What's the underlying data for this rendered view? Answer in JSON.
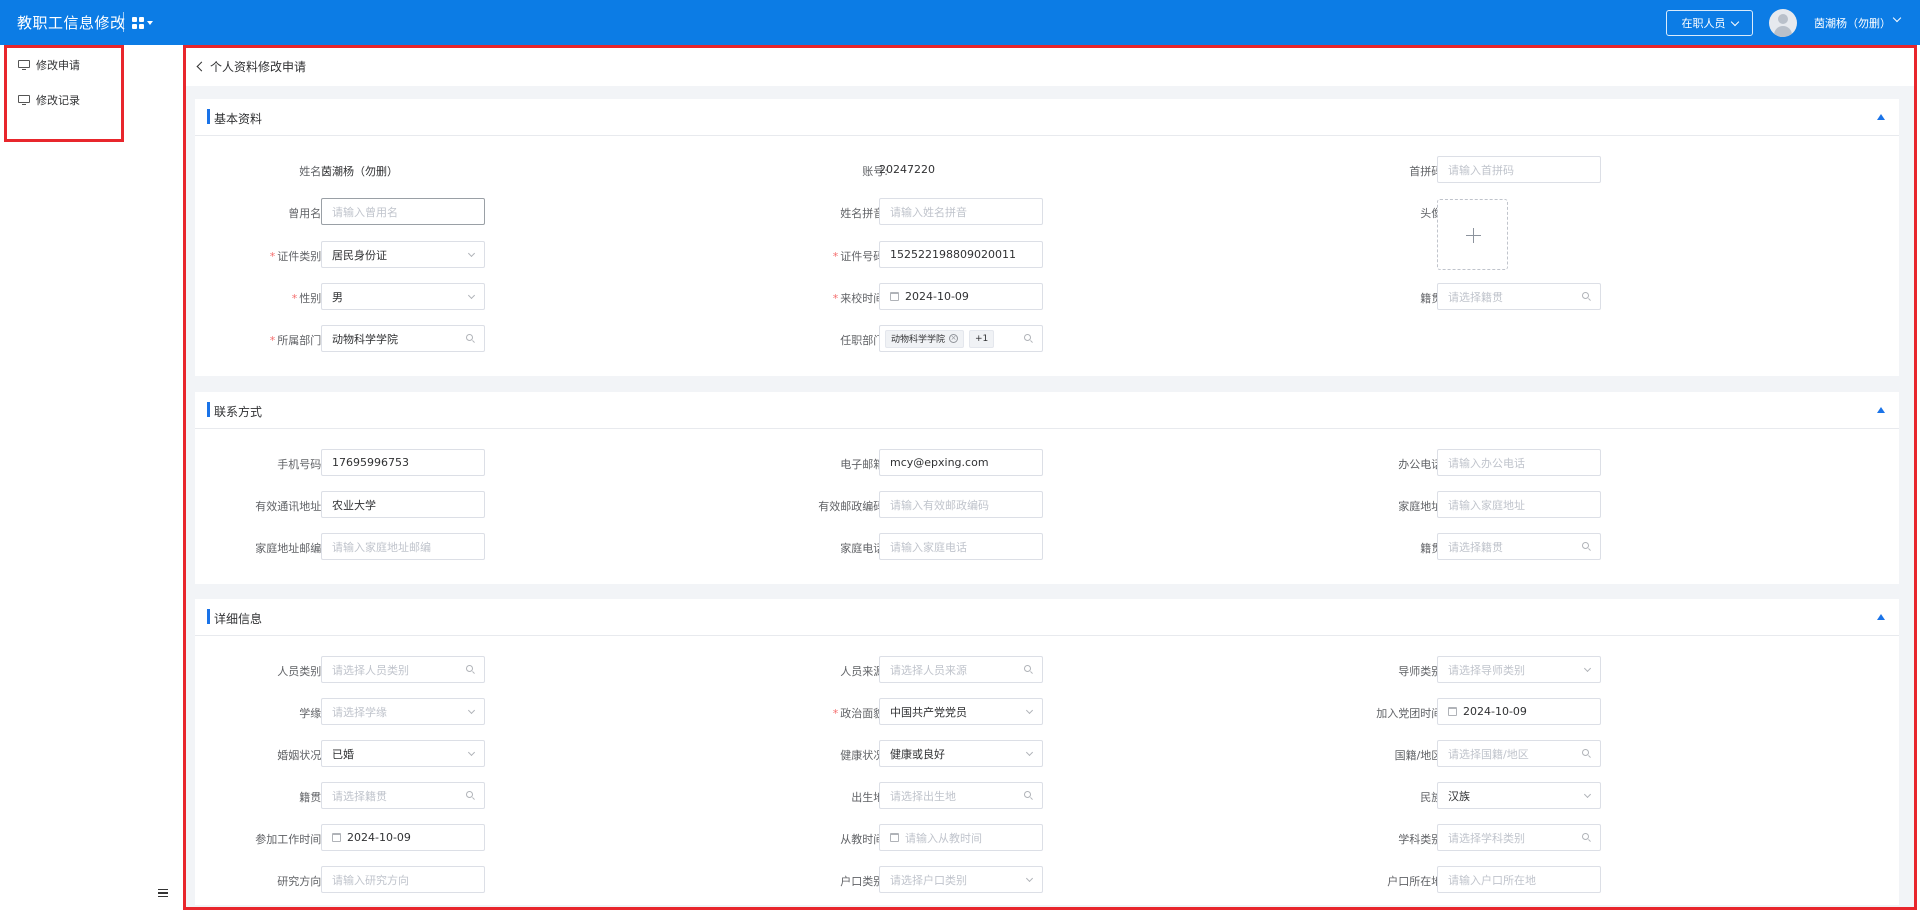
{
  "header": {
    "app_title": "教职工信息修改",
    "status_select": "在职人员",
    "user_name": "茵潮杨（勿删）"
  },
  "sidebar": {
    "items": [
      {
        "label": "修改申请"
      },
      {
        "label": "修改记录"
      }
    ]
  },
  "breadcrumb": "个人资料修改申请",
  "sections": {
    "basic": {
      "title": "基本资料",
      "name_label": "姓名:",
      "name_value": "茵潮杨（勿删）",
      "account_label": "账号:",
      "account_value": "20247220",
      "initials_label": "首拼码:",
      "initials_placeholder": "请输入首拼码",
      "former_name_label": "曾用名:",
      "former_name_placeholder": "请输入曾用名",
      "name_pinyin_label": "姓名拼音:",
      "name_pinyin_placeholder": "请输入姓名拼音",
      "avatar_label": "头像:",
      "id_type_label": "证件类别:",
      "id_type_value": "居民身份证",
      "id_number_label": "证件号码:",
      "id_number_value": "152522198809020011",
      "gender_label": "性别:",
      "gender_value": "男",
      "arrival_label": "来校时间:",
      "arrival_value": "2024-10-09",
      "native_label": "籍贯:",
      "native_placeholder": "请选择籍贯",
      "dept_label": "所属部门:",
      "dept_value": "动物科学学院",
      "job_dept_label": "任职部门:",
      "job_dept_tag": "动物科学学院",
      "job_dept_more": "+1"
    },
    "contact": {
      "title": "联系方式",
      "mobile_label": "手机号码:",
      "mobile_value": "17695996753",
      "email_label": "电子邮箱:",
      "email_value": "mcy@epxing.com",
      "office_phone_label": "办公电话:",
      "office_phone_placeholder": "请输入办公电话",
      "address_label": "有效通讯地址:",
      "address_value": "农业大学",
      "postcode_label": "有效邮政编码:",
      "postcode_placeholder": "请输入有效邮政编码",
      "home_addr_label": "家庭地址:",
      "home_addr_placeholder": "请输入家庭地址",
      "home_post_label": "家庭地址邮编:",
      "home_post_placeholder": "请输入家庭地址邮编",
      "home_phone_label": "家庭电话:",
      "home_phone_placeholder": "请输入家庭电话",
      "native_label": "籍贯:",
      "native_placeholder": "请选择籍贯"
    },
    "detail": {
      "title": "详细信息",
      "staff_type_label": "人员类别:",
      "staff_type_placeholder": "请选择人员类别",
      "staff_source_label": "人员来源:",
      "staff_source_placeholder": "请选择人员来源",
      "tutor_type_label": "导师类别:",
      "tutor_type_placeholder": "请选择导师类别",
      "degree_source_label": "学缘:",
      "degree_source_placeholder": "请选择学缘",
      "political_label": "政治面貌:",
      "political_value": "中国共产党党员",
      "party_date_label": "加入党团时间:",
      "party_date_value": "2024-10-09",
      "marital_label": "婚姻状况:",
      "marital_value": "已婚",
      "health_label": "健康状况:",
      "health_value": "健康或良好",
      "nationality_label": "国籍/地区:",
      "nationality_placeholder": "请选择国籍/地区",
      "native_label": "籍贯:",
      "native_placeholder": "请选择籍贯",
      "birthplace_label": "出生地:",
      "birthplace_placeholder": "请选择出生地",
      "ethnic_label": "民族:",
      "ethnic_value": "汉族",
      "work_date_label": "参加工作时间:",
      "work_date_value": "2024-10-09",
      "teach_date_label": "从教时间:",
      "teach_date_placeholder": "请输入从教时间",
      "subject_label": "学科类别:",
      "subject_placeholder": "请选择学科类别",
      "research_label": "研究方向:",
      "research_placeholder": "请输入研究方向",
      "hukou_type_label": "户口类别:",
      "hukou_type_placeholder": "请选择户口类别",
      "hukou_place_label": "户口所在地:",
      "hukou_place_placeholder": "请输入户口所在地"
    }
  },
  "colors": {
    "header_bg": "#0c7ce5",
    "accent": "#1a73e8",
    "required": "#f56c6c",
    "annotation": "#e8262c"
  }
}
